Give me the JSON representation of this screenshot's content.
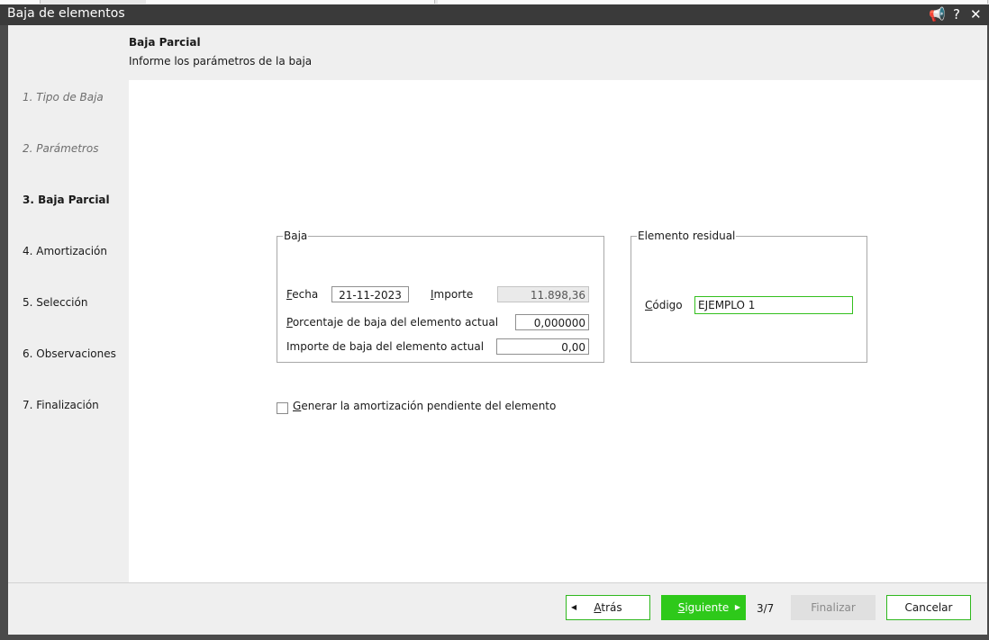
{
  "window": {
    "title": "Baja de elementos",
    "controls": {
      "notify": "📢",
      "help": "?",
      "close": "✕"
    }
  },
  "header": {
    "title": "Baja Parcial",
    "subtitle": "Informe los parámetros de la baja"
  },
  "steps": [
    {
      "label": "1. Tipo de Baja",
      "state": "done"
    },
    {
      "label": "2. Parámetros",
      "state": "done"
    },
    {
      "label": "3. Baja Parcial",
      "state": "current"
    },
    {
      "label": "4. Amortización",
      "state": "pending"
    },
    {
      "label": "5. Selección",
      "state": "pending"
    },
    {
      "label": "6. Observaciones",
      "state": "pending"
    },
    {
      "label": "7. Finalización",
      "state": "pending"
    }
  ],
  "baja": {
    "legend": "Baja",
    "fecha_label_first": "F",
    "fecha_label_rest": "echa",
    "fecha_value": "21-11-2023",
    "importe_label_first": "I",
    "importe_label_rest": "mporte",
    "importe_value": "11.898,36",
    "porcentaje_label_first": "P",
    "porcentaje_label_rest": "orcentaje de baja del elemento actual",
    "porcentaje_value": "0,000000",
    "importe_baja_label": "Importe de baja del elemento actual",
    "importe_baja_value": "0,00"
  },
  "residual": {
    "legend": "Elemento residual",
    "codigo_label_first": "C",
    "codigo_label_rest": "ódigo",
    "codigo_value": "EJEMPLO 1"
  },
  "options": {
    "generar_first": "G",
    "generar_rest": "enerar la amortización pendiente del elemento",
    "generar_checked": false
  },
  "footer": {
    "back_first": "A",
    "back_rest": "trás",
    "next_first": "S",
    "next_rest": "iguiente",
    "pager": "3/7",
    "finish_label": "Finalizar",
    "cancel_label": "Cancelar"
  },
  "colors": {
    "accent": "#2ec91a",
    "titlebar": "#3a3a3a"
  }
}
